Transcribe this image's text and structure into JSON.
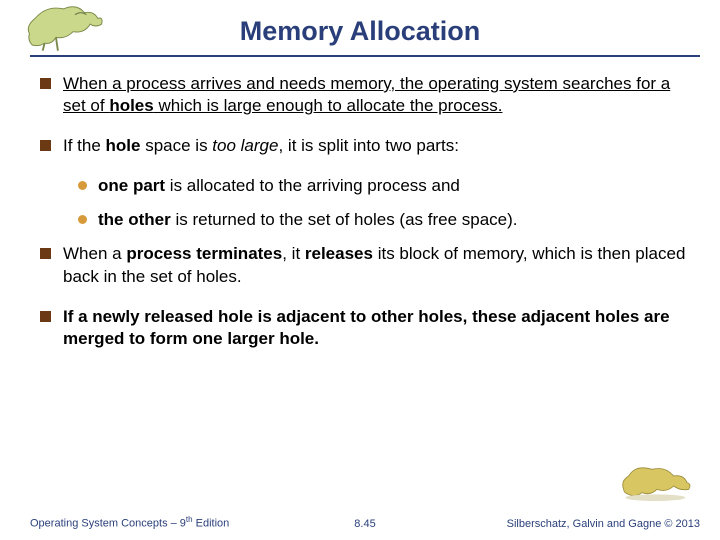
{
  "header": {
    "title": "Memory Allocation"
  },
  "bullets": {
    "b1": {
      "pre": "When a process arrives and needs memory, the operating system searches for a set of ",
      "bold": "holes",
      "post": " which is large enough to allocate the process."
    },
    "b2": {
      "pre": "If the ",
      "bold": "hole",
      "mid": " space is ",
      "ital": "too large",
      "post": ", it is split into two parts:"
    },
    "s1": {
      "bold": "one part",
      "post": " is allocated to the arriving process and"
    },
    "s2": {
      "bold": "the other",
      "post": " is returned to the set of holes (as free space)."
    },
    "b3": {
      "pre": "When a ",
      "bold1": "process terminates",
      "mid": ", it ",
      "bold2": "releases",
      "post": " its block of memory, which is then placed back in the set of holes."
    },
    "b4": {
      "text": "If a newly released hole is adjacent to other holes, these adjacent holes are merged to form one larger hole."
    }
  },
  "footer": {
    "left_pre": "Operating System Concepts – 9",
    "left_sup": "th",
    "left_post": " Edition",
    "center": "8.45",
    "right": "Silberschatz, Galvin and Gagne © 2013"
  },
  "icons": {
    "dino_tl": "dinosaur-icon",
    "dino_br": "dinosaur-icon"
  }
}
